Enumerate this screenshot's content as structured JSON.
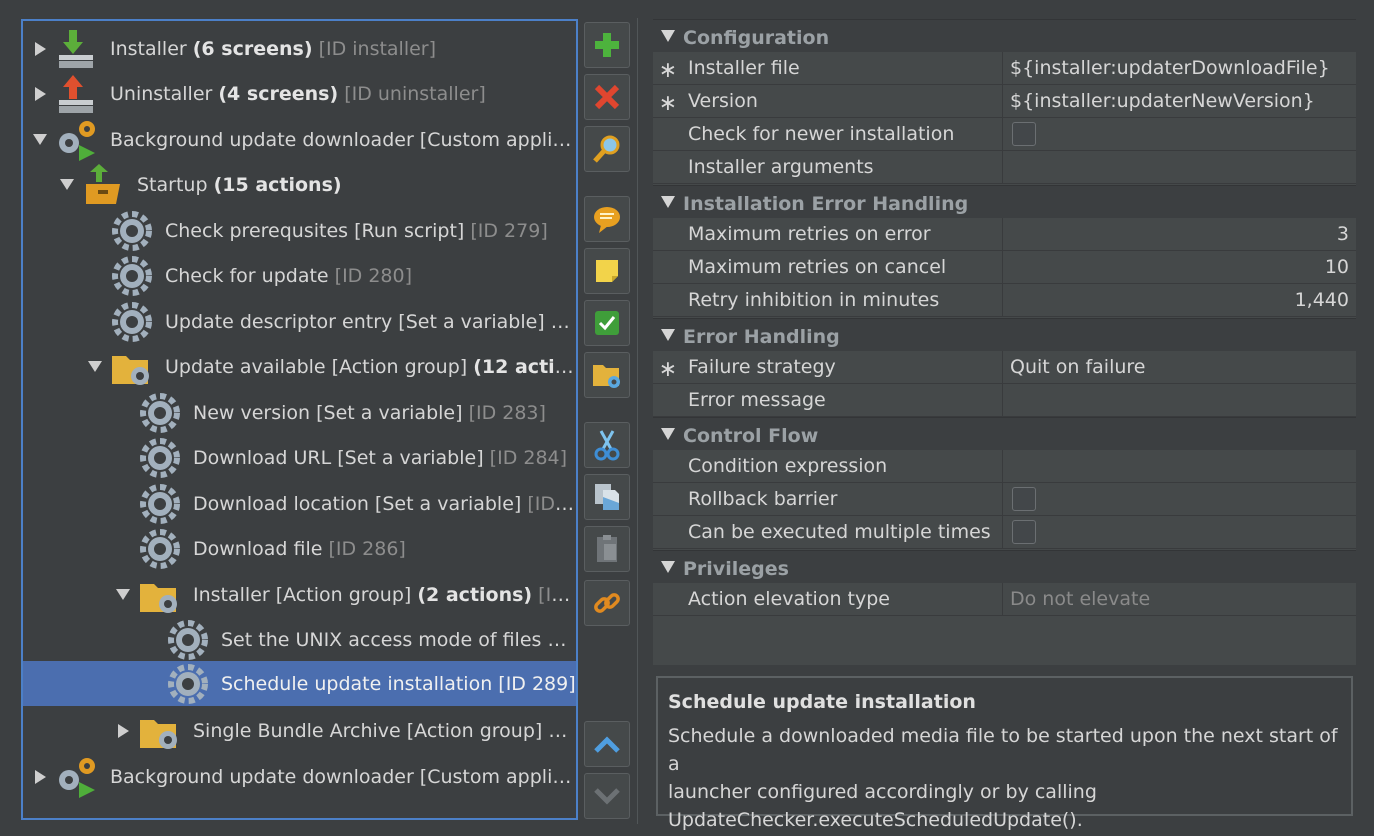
{
  "tree": {
    "rows": [
      {
        "name": "Installer",
        "bold": "(6 screens)",
        "id": "[ID installer]"
      },
      {
        "name": "Uninstaller",
        "bold": "(4 screens)",
        "id": "[ID uninstaller]"
      },
      {
        "name": "Background update downloader [Custom applic...",
        "bold": "",
        "id": ""
      },
      {
        "name": "Startup",
        "bold": "(15 actions)",
        "id": ""
      },
      {
        "name": "Check prerequsites [Run script]",
        "bold": "",
        "id": "[ID 279]"
      },
      {
        "name": "Check for update",
        "bold": "",
        "id": "[ID 280]"
      },
      {
        "name": "Update descriptor entry [Set a variable]",
        "bold": "",
        "id": "[I..."
      },
      {
        "name": "Update available [Action group]",
        "bold": "(12 actio...",
        "id": ""
      },
      {
        "name": "New version [Set a variable]",
        "bold": "",
        "id": "[ID 283]"
      },
      {
        "name": "Download URL [Set a variable]",
        "bold": "",
        "id": "[ID 284]"
      },
      {
        "name": "Download location [Set a variable]",
        "bold": "",
        "id": "[ID ..."
      },
      {
        "name": "Download file",
        "bold": "",
        "id": "[ID 286]"
      },
      {
        "name": "Installer [Action group]",
        "bold": "(2 actions)",
        "id": "[ID ..."
      },
      {
        "name": "Set the UNIX access mode of files an...",
        "bold": "",
        "id": ""
      },
      {
        "name": "Schedule update installation [ID 289]",
        "bold": "",
        "id": ""
      },
      {
        "name": "Single Bundle Archive [Action group]",
        "bold": "(...",
        "id": ""
      },
      {
        "name": "Background update downloader [Custom applic...",
        "bold": "",
        "id": ""
      }
    ]
  },
  "toolbar": {
    "icons": [
      "add-icon",
      "delete-icon",
      "search-icon",
      "comment-icon",
      "note-icon",
      "check-icon",
      "folder-gear-icon",
      "cut-icon",
      "copy-icon",
      "paste-icon",
      "link-icon",
      "move-up-icon",
      "move-down-icon"
    ]
  },
  "properties": {
    "sections": [
      {
        "title": "Configuration",
        "props": [
          {
            "name": "Installer file",
            "value": "${installer:updaterDownloadFile}",
            "req": "∗"
          },
          {
            "name": "Version",
            "value": "${installer:updaterNewVersion}",
            "req": "∗"
          },
          {
            "name": "Check for newer installation",
            "value": "",
            "req": ""
          },
          {
            "name": "Installer arguments",
            "value": "",
            "req": ""
          }
        ]
      },
      {
        "title": "Installation Error Handling",
        "props": [
          {
            "name": "Maximum retries on error",
            "value": "3",
            "req": ""
          },
          {
            "name": "Maximum retries on cancel",
            "value": "10",
            "req": ""
          },
          {
            "name": "Retry inhibition in minutes",
            "value": "1,440",
            "req": ""
          }
        ]
      },
      {
        "title": "Error Handling",
        "props": [
          {
            "name": "Failure strategy",
            "value": "Quit on failure",
            "req": "∗"
          },
          {
            "name": "Error message",
            "value": "",
            "req": ""
          }
        ]
      },
      {
        "title": "Control Flow",
        "props": [
          {
            "name": "Condition expression",
            "value": "",
            "req": ""
          },
          {
            "name": "Rollback barrier",
            "value": "",
            "req": ""
          },
          {
            "name": "Can be executed multiple times",
            "value": "",
            "req": ""
          }
        ]
      },
      {
        "title": "Privileges",
        "props": [
          {
            "name": "Action elevation type",
            "value": "Do not elevate",
            "req": ""
          }
        ]
      }
    ]
  },
  "description": {
    "title": "Schedule update installation",
    "lines": [
      "Schedule a downloaded media file to be started upon the next start of a",
      "launcher configured accordingly or by calling",
      "UpdateChecker.executeScheduledUpdate()."
    ]
  }
}
